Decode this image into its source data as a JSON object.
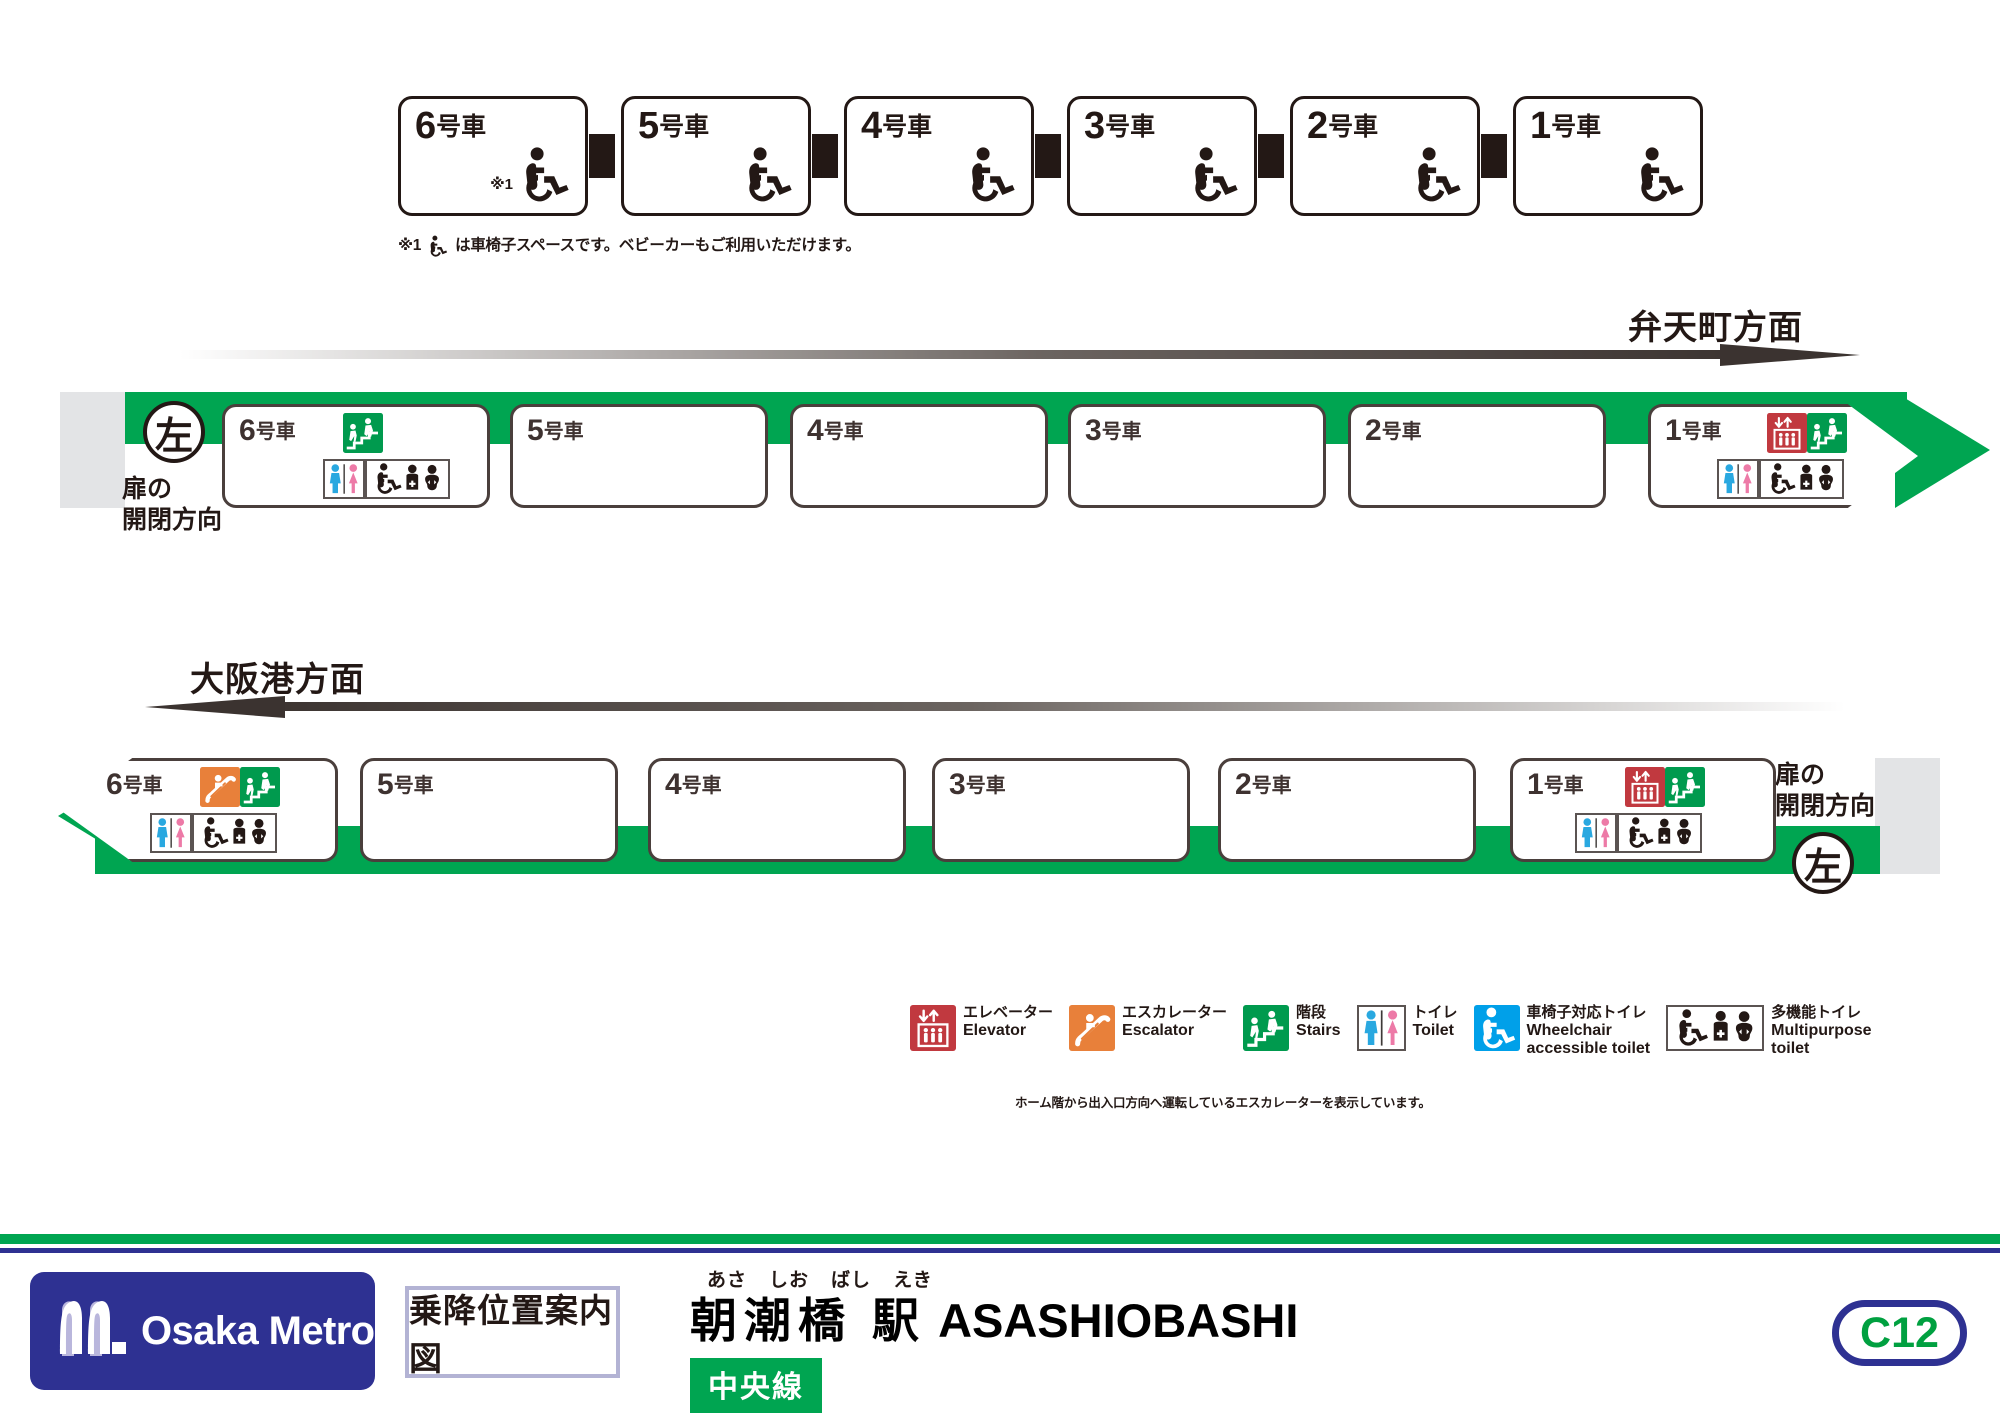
{
  "top_row": {
    "cars": [
      {
        "label_number": "6",
        "label_suffix": "号車",
        "has_wheelchair": true,
        "note_marker": "※1"
      },
      {
        "label_number": "5",
        "label_suffix": "号車",
        "has_wheelchair": true,
        "note_marker": ""
      },
      {
        "label_number": "4",
        "label_suffix": "号車",
        "has_wheelchair": true,
        "note_marker": ""
      },
      {
        "label_number": "3",
        "label_suffix": "号車",
        "has_wheelchair": true,
        "note_marker": ""
      },
      {
        "label_number": "2",
        "label_suffix": "号車",
        "has_wheelchair": true,
        "note_marker": ""
      },
      {
        "label_number": "1",
        "label_suffix": "号車",
        "has_wheelchair": true,
        "note_marker": ""
      }
    ],
    "footnote_prefix": "※1",
    "footnote_text": "は車椅子スペースです。ベビーカーもご利用いただけます。"
  },
  "upper_platform": {
    "direction_label": "弁天町方面",
    "door_side_label_line1": "扉の",
    "door_side_label_line2": "開閉方向",
    "door_side_mark": "左",
    "cars": [
      {
        "label_number": "6",
        "label_suffix": "号車",
        "facilities": [
          "stairs",
          "toilet",
          "multipurpose-toilet"
        ]
      },
      {
        "label_number": "5",
        "label_suffix": "号車",
        "facilities": []
      },
      {
        "label_number": "4",
        "label_suffix": "号車",
        "facilities": []
      },
      {
        "label_number": "3",
        "label_suffix": "号車",
        "facilities": []
      },
      {
        "label_number": "2",
        "label_suffix": "号車",
        "facilities": []
      },
      {
        "label_number": "1",
        "label_suffix": "号車",
        "facilities": [
          "elevator",
          "stairs",
          "toilet",
          "multipurpose-toilet"
        ]
      }
    ]
  },
  "lower_platform": {
    "direction_label": "大阪港方面",
    "door_side_label_line1": "扉の",
    "door_side_label_line2": "開閉方向",
    "door_side_mark": "左",
    "cars": [
      {
        "label_number": "6",
        "label_suffix": "号車",
        "facilities": [
          "escalator",
          "stairs",
          "toilet",
          "multipurpose-toilet"
        ]
      },
      {
        "label_number": "5",
        "label_suffix": "号車",
        "facilities": []
      },
      {
        "label_number": "4",
        "label_suffix": "号車",
        "facilities": []
      },
      {
        "label_number": "3",
        "label_suffix": "号車",
        "facilities": []
      },
      {
        "label_number": "2",
        "label_suffix": "号車",
        "facilities": []
      },
      {
        "label_number": "1",
        "label_suffix": "号車",
        "facilities": [
          "elevator",
          "stairs",
          "toilet",
          "multipurpose-toilet"
        ]
      }
    ]
  },
  "legend": {
    "items": [
      {
        "icon": "elevator-icon",
        "ja": "エレベーター",
        "en": "Elevator",
        "color": "#c1393f"
      },
      {
        "icon": "escalator-icon",
        "ja": "エスカレーター",
        "en": "Escalator",
        "color": "#e8803a"
      },
      {
        "icon": "stairs-icon",
        "ja": "階段",
        "en": "Stairs",
        "color": "#009a4e"
      },
      {
        "icon": "toilet-icon",
        "ja": "トイレ",
        "en": "Toilet",
        "color": "#ffffff"
      },
      {
        "icon": "wheelchair-toilet-icon",
        "ja": "車椅子対応トイレ",
        "en": "Wheelchair\naccessible toilet",
        "color": "#00a0e9"
      },
      {
        "icon": "multipurpose-toilet-icon",
        "ja": "多機能トイレ",
        "en": "Multipurpose\ntoilet",
        "color": "#ffffff"
      }
    ],
    "escalator_note": "ホーム階から出入口方向へ運転しているエスカレーターを表示しています。"
  },
  "footer": {
    "brand": "Osaka Metro",
    "map_kind": "乗降位置案内図",
    "furigana": [
      "あさ",
      "しお",
      "ばし",
      "えき"
    ],
    "station_name_ja": "朝潮橋 駅",
    "station_name_en": "ASASHIOBASHI",
    "line_name": "中央線",
    "station_code": "C12"
  },
  "colors": {
    "green": "#00a551",
    "navy": "#2e3192",
    "elevator_red": "#c1393f",
    "escalator_orange": "#e8803a",
    "stairs_green": "#009a4e",
    "toilet_blue": "#29a8e0",
    "toilet_pink": "#ed7aa7",
    "wheelchair_blue": "#00a0e9",
    "dark": "#231815"
  }
}
